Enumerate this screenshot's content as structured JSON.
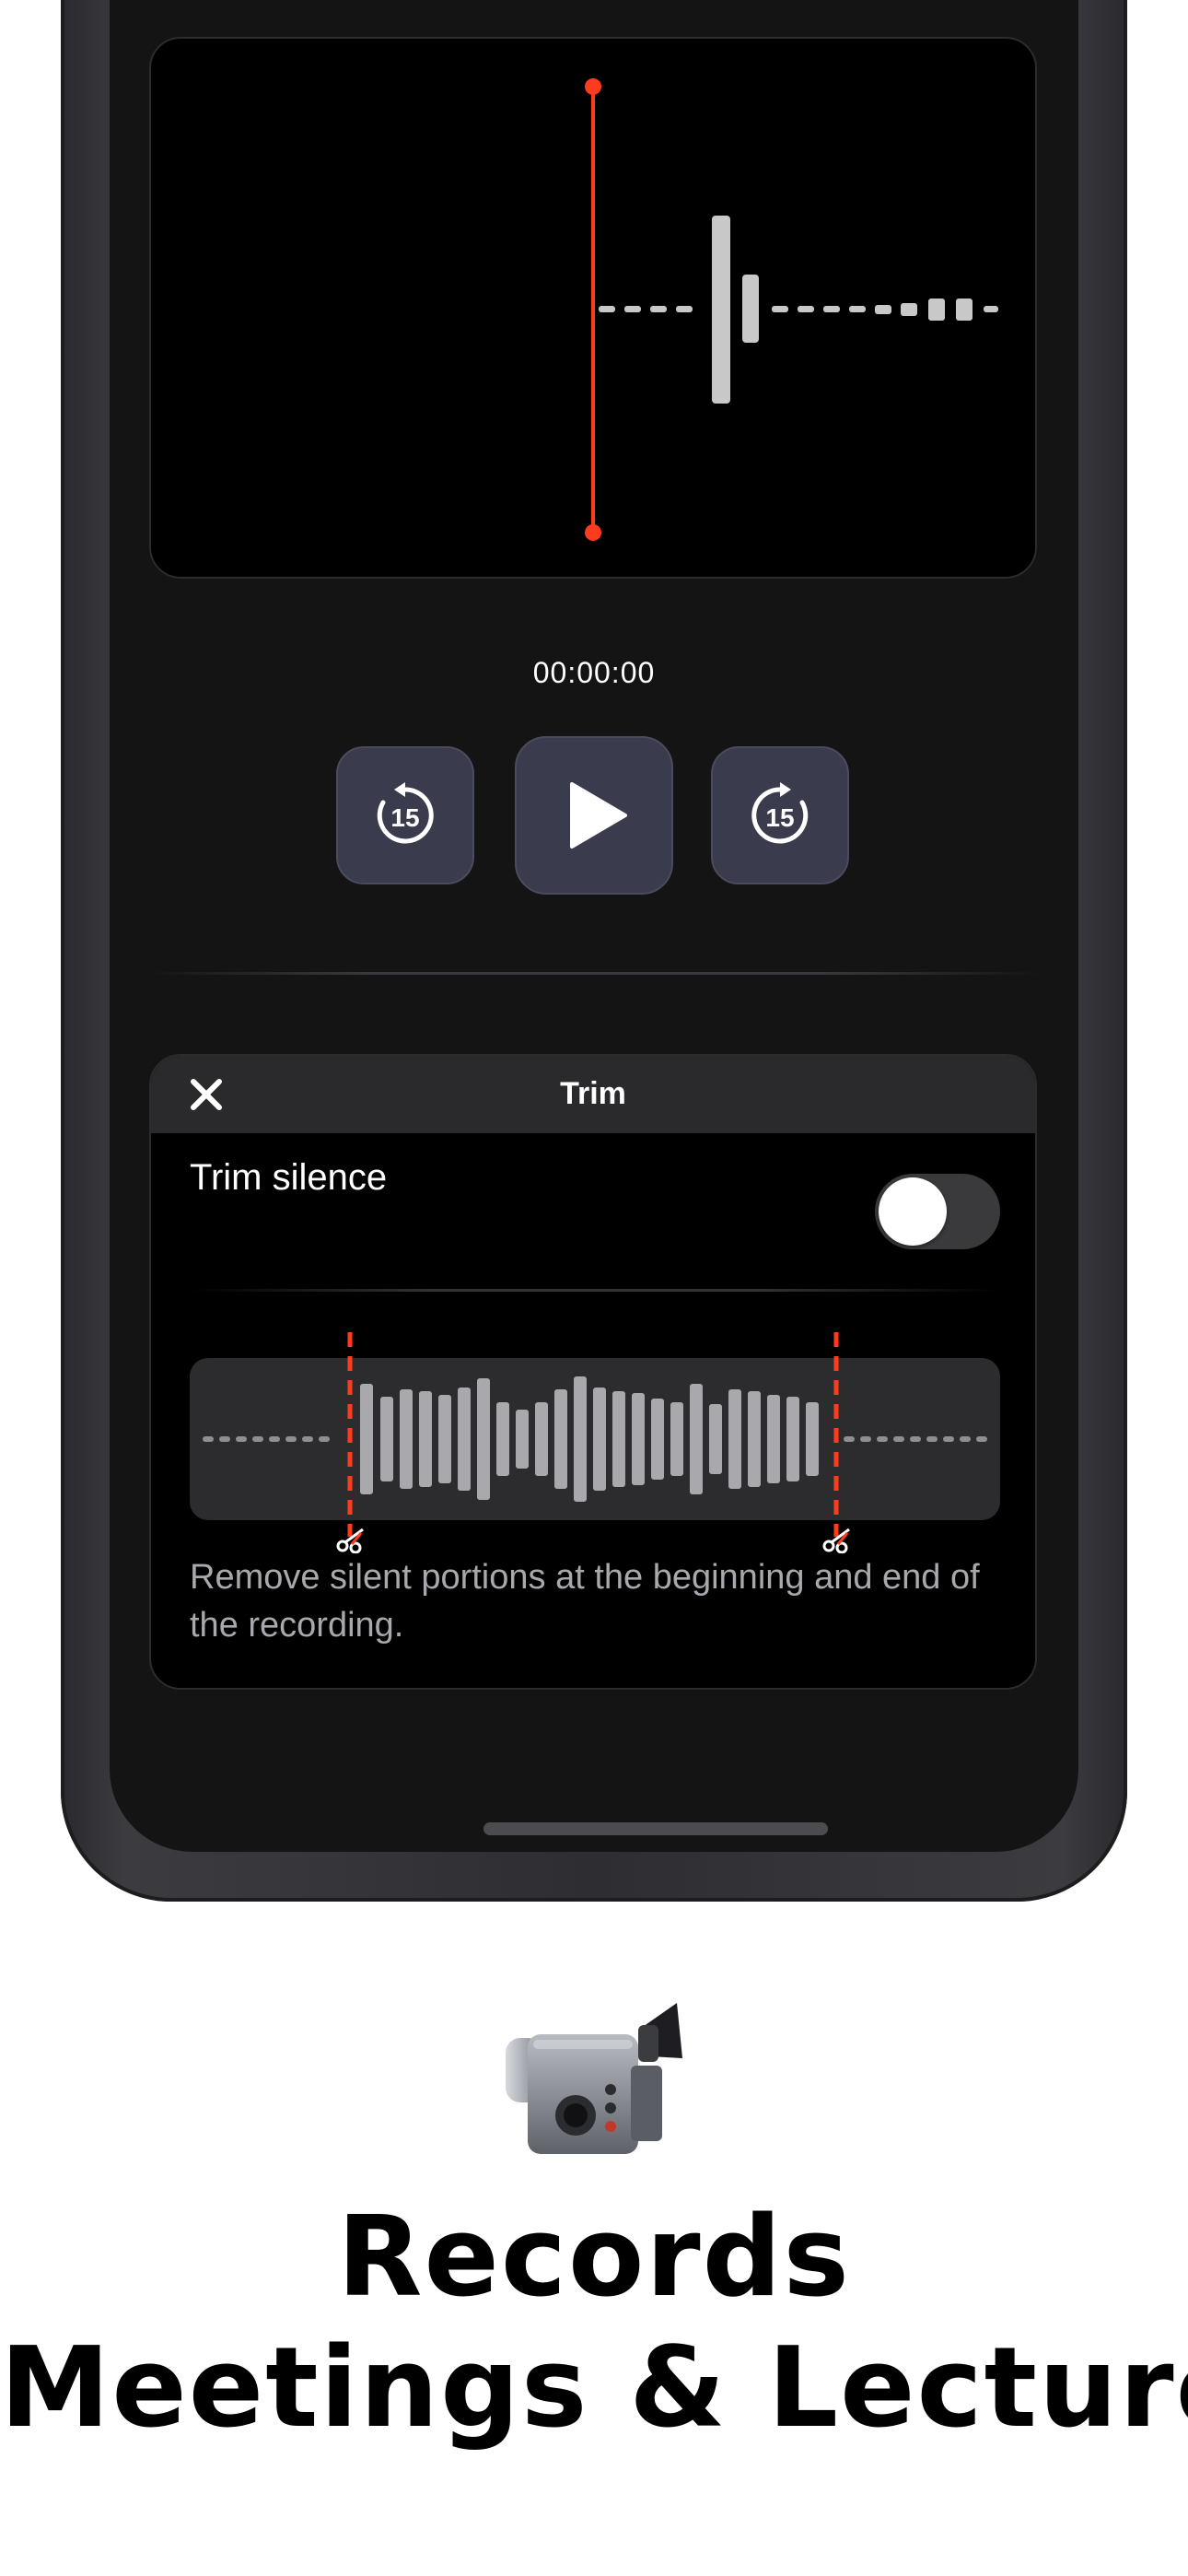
{
  "player": {
    "time": "00:00:00",
    "skip_back_label": "15",
    "skip_forward_label": "15",
    "playhead_color": "#ff3b1f"
  },
  "trim": {
    "title": "Trim",
    "trim_silence_label": "Trim silence",
    "trim_silence_enabled": false,
    "description": "Remove silent portions at the beginning and end of the recording."
  },
  "icons": {
    "close": "close-icon",
    "skip_back": "skip-back-15-icon",
    "play": "play-icon",
    "skip_forward": "skip-forward-15-icon",
    "scissors": "scissors-icon",
    "camcorder": "camcorder-icon"
  },
  "caption": {
    "line1": "Records",
    "line2": "Meetings & Lectures"
  }
}
